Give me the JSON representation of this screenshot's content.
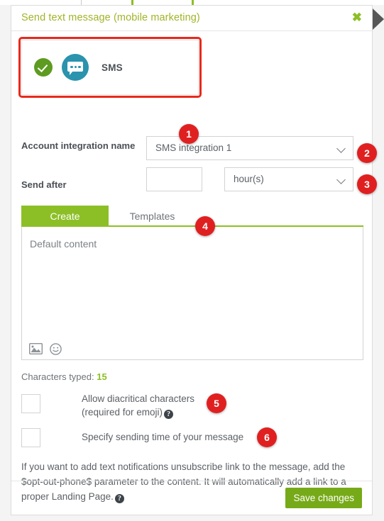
{
  "dialog": {
    "title": "Send text message (mobile marketing)",
    "close_label": "✖",
    "accent_green": "#8cbf26",
    "title_color": "#a2b429",
    "highlight_color": "#e8291c",
    "badge_color": "#e02020"
  },
  "channel": {
    "label": "SMS",
    "selected": true,
    "check_icon": "check-icon",
    "sms_icon": "sms-bubble-icon"
  },
  "fields": {
    "integration": {
      "label": "Account integration name",
      "value": "SMS integration 1"
    },
    "send_after": {
      "label": "Send after",
      "amount_value": "",
      "amount_placeholder": "",
      "unit_value": "hour(s)"
    }
  },
  "tabs": [
    {
      "label": "Create",
      "active": true
    },
    {
      "label": "Templates",
      "active": false
    }
  ],
  "editor": {
    "placeholder": "Default content",
    "image_icon": "image-icon",
    "emoji_icon": "emoji-icon"
  },
  "char_counter": {
    "label": "Characters typed:",
    "count": "15"
  },
  "options": [
    {
      "line1": "Allow diacritical characters",
      "line2": "(required for emoji)",
      "has_help": true,
      "checked": false
    },
    {
      "line1": "Specify sending time of your message",
      "line2": "",
      "has_help": false,
      "checked": false
    }
  ],
  "info": {
    "text": "If you want to add text notifications unsubscribe link to the message, add the $opt-out-phone$ parameter to the content. It will automatically add a link to a proper Landing Page.",
    "has_help": true
  },
  "footer": {
    "save_label": "Save changes"
  },
  "badges": [
    {
      "number": "1"
    },
    {
      "number": "2"
    },
    {
      "number": "3"
    },
    {
      "number": "4"
    },
    {
      "number": "5"
    },
    {
      "number": "6"
    }
  ],
  "help_glyph": "?"
}
